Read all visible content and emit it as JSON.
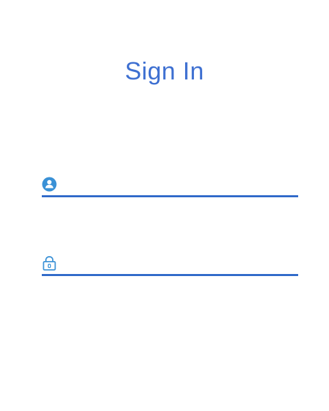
{
  "title": "Sign In",
  "username": {
    "icon": "user-circle-icon",
    "value": "",
    "placeholder": ""
  },
  "password": {
    "icon": "lock-icon",
    "value": "",
    "placeholder": ""
  },
  "colors": {
    "accent": "#3d6fd1",
    "underline": "#2f69c9",
    "icon": "#3a91d6",
    "background": "#ffffff"
  }
}
